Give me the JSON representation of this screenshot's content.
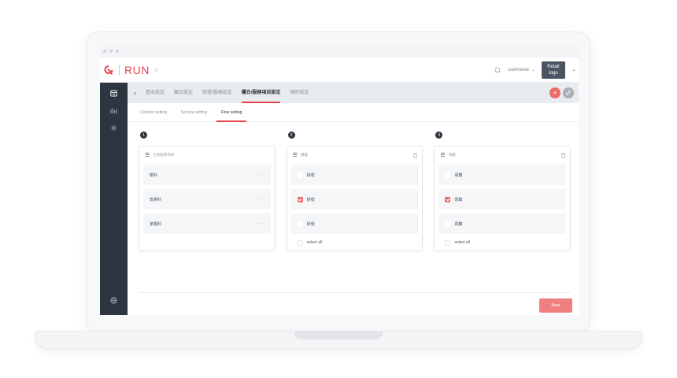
{
  "app": {
    "logo_text": "RUN"
  },
  "header": {
    "username": "username",
    "retail_logo_line1": "Retail",
    "retail_logo_line2": "logo"
  },
  "top_tabs": [
    {
      "label": "基本設定"
    },
    {
      "label": "顯示設定"
    },
    {
      "label": "取號/服務設定"
    },
    {
      "label": "櫃台/服務項目設定",
      "active": true
    },
    {
      "label": "預約設定"
    }
  ],
  "sub_tabs": [
    {
      "label": "Counter setting"
    },
    {
      "label": "Service setting"
    },
    {
      "label": "Flow setting",
      "active": true
    }
  ],
  "columns": [
    {
      "step": "1",
      "title": "主要服務項目",
      "rows": [
        {
          "label": "眼科",
          "more": "···"
        },
        {
          "label": "皮膚科",
          "more": "···"
        },
        {
          "label": "家醫科",
          "more": "···"
        }
      ]
    },
    {
      "step": "2",
      "title": "櫃檯",
      "select_all": "select all",
      "rows": [
        {
          "label": "掛號",
          "checked": false
        },
        {
          "label": "掛號",
          "checked": true
        },
        {
          "label": "掛號",
          "checked": false
        }
      ]
    },
    {
      "step": "3",
      "title": "領藥",
      "select_all": "select all",
      "rows": [
        {
          "label": "領藥",
          "checked": false
        },
        {
          "label": "領藥",
          "checked": true
        },
        {
          "label": "領藥",
          "checked": false
        }
      ]
    }
  ],
  "actions": {
    "save_label": "Save",
    "add_symbol": "+"
  },
  "colors": {
    "accent": "#e8434f",
    "sidebar": "#2d3540",
    "save": "#f08080"
  }
}
